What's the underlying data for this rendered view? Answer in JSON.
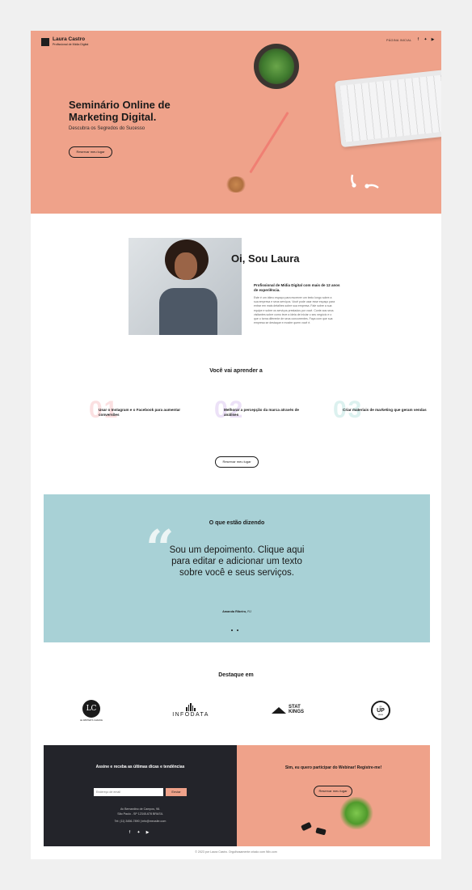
{
  "header": {
    "brand_name": "Laura Castro",
    "brand_subtitle": "Profissional de Mídia Digital",
    "nav_home": "PÁGINA INICIAL",
    "social_icons": [
      "facebook-icon",
      "twitter-icon",
      "youtube-icon"
    ]
  },
  "hero": {
    "title": "Seminário Online de Marketing Digital.",
    "subtitle": "Descubra os Segredos do Sucesso",
    "cta": "Reservar meu lugar",
    "background": "#efa28a"
  },
  "about": {
    "greeting": "Oi, Sou Laura",
    "role": "Profissional de Mídia Digital com mais de 12 anos de experiência.",
    "body": "Este é um ótimo espaço para escrever um texto longo sobre a sua empresa e seus serviços. Você pode usar esse espaço para entrar em mais detalhes sobre sua empresa. Fale sobre a sua equipe e sobre os serviços prestados por você. Conte aos seus visitantes sobre como teve a ideia de iniciar o seu negócio e o que o torna diferente de seus concorrentes. Faça com que sua empresa se destaque e mostre quem você é."
  },
  "learn": {
    "title": "Você vai aprender a",
    "items": [
      {
        "number": "01",
        "text": "Usar o Instagram e o Facebook para aumentar conversões",
        "color": "#fbe0e1"
      },
      {
        "number": "02",
        "text": "Melhorar a percepção da marca através de análises",
        "color": "#ece1f7"
      },
      {
        "number": "03",
        "text": "Criar materiais de marketing que geram vendas",
        "color": "#dcf1ef"
      }
    ],
    "cta": "Reservar meu lugar"
  },
  "testimonial": {
    "title": "O que estão dizendo",
    "quote": "Sou um depoimento. Clique aqui para editar e adicionar um texto sobre você e seus serviços.",
    "author": "Amanda Ribeiro,",
    "location": "RJ",
    "background": "#a8d1d6"
  },
  "featured": {
    "title": "Destaque em",
    "logos": {
      "lc_mark": "LC",
      "lc_caption": "LE WRITER'S CHANCE",
      "infodata": "INFODATA",
      "statkings_1": "STAT",
      "statkings_2": "KINGS",
      "up_top": "go",
      "up_mid": "UP",
      "up_bot": "press"
    }
  },
  "footer": {
    "newsletter_title": "Assine e receba as últimas dicas e tendências",
    "email_placeholder": "Endereço de email",
    "submit": "Enviar",
    "address_1": "Av Bernardino de Campos, 98.",
    "address_2": "São Paulo - SP 12345-678 BRASIL",
    "contact": "Tel: (11) 3456-7890  |  info@meusite.com",
    "webinar_title": "Sim, eu quero participar do Webinar! Registre-me!",
    "webinar_cta": "Reservar meu lugar",
    "copyright": "© 2023 por Laura Castro. Orgulhosamente criado com Wix.com"
  }
}
